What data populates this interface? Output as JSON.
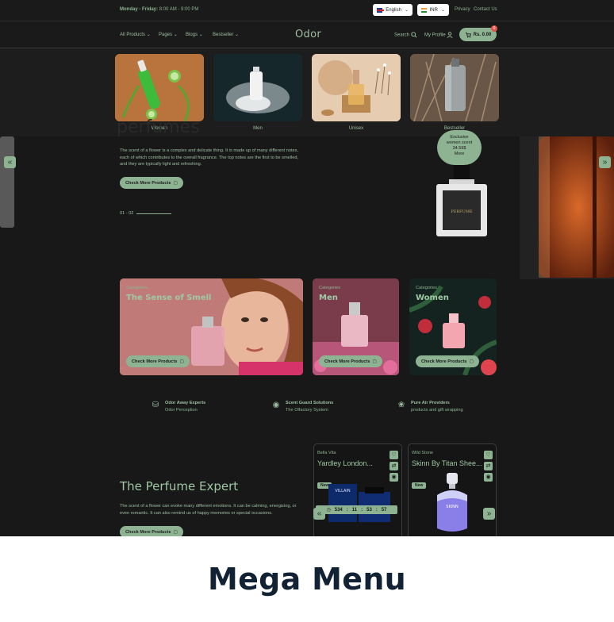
{
  "topbar": {
    "hours_day": "Monday - Friday:",
    "hours_time": "8:00 AM - 9:00 PM",
    "language": "English",
    "currency": "INR",
    "links": [
      "Privacy",
      "Contact Us"
    ]
  },
  "nav": {
    "items": [
      "All Products",
      "Pages",
      "Blogs",
      "Bestseller"
    ],
    "logo": "Odor",
    "search": "Search",
    "profile": "My Profile",
    "cart_total": "Rs. 0.00",
    "cart_count": "0"
  },
  "mega_menu": {
    "items": [
      {
        "label": "Women"
      },
      {
        "label": "Men"
      },
      {
        "label": "Unisex"
      },
      {
        "label": "Bestseller"
      }
    ]
  },
  "hero": {
    "title": "perfumes",
    "text": "The scent of a flower is a complex and delicate thing. It is made up of many different notes, each of which contributes to the overall fragrance. The top notes are the first to be smelled, and they are typically light and refreshing.",
    "button": "Check More Products",
    "pager": "01 - 02",
    "promo": [
      "Exclusive",
      "women scent",
      "34.59$",
      "More"
    ],
    "bottle_label": "PERFUME"
  },
  "categories": [
    {
      "small": "Categories",
      "title": "The Sense of Smell",
      "button": "Check More Products"
    },
    {
      "small": "Categories",
      "title": "Men",
      "button": "Check More Products"
    },
    {
      "small": "Categories",
      "title": "Women",
      "button": "Check More Products"
    }
  ],
  "features": [
    {
      "title": "Odor Away Experts",
      "sub": "Odor Perception"
    },
    {
      "title": "Scent Guard Solutions",
      "sub": "The Olfactory System"
    },
    {
      "title": "Pure Air Providers",
      "sub": "products and gift wrapping"
    }
  ],
  "expert": {
    "title": "The Perfume Expert",
    "text": "The scent of a flower can evoke many different emotions. It can be calming, energizing, or even romantic. It can also remind us of happy memories or special occasions.",
    "button": "Check More Products"
  },
  "products": [
    {
      "brand": "Bella Vita",
      "name": "Yardley London...",
      "badge": "New",
      "box_label": "VILLAIN"
    },
    {
      "brand": "Wild Stone",
      "name": "Skinn By Titan Shee...",
      "badge": "New",
      "box_label": "SKINN"
    }
  ],
  "timer": {
    "d": "534",
    "h": "11",
    "m": "53",
    "s": "57"
  },
  "caption": "Mega Menu",
  "colors": {
    "accent": "#8db392",
    "background": "#181818",
    "caption_text": "#102234"
  }
}
